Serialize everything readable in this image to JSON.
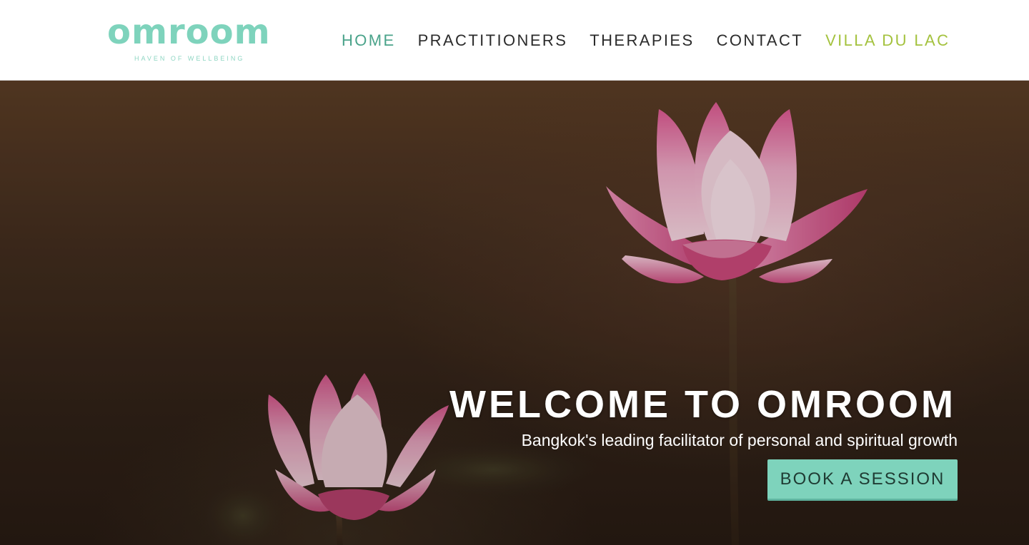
{
  "brand": {
    "name": "omroom",
    "tagline": "HAVEN OF WELLBEING",
    "color": "#7ed3bc"
  },
  "nav": {
    "items": [
      {
        "label": "HOME",
        "state": "active",
        "color": "#4aa38a"
      },
      {
        "label": "PRACTITIONERS"
      },
      {
        "label": "THERAPIES"
      },
      {
        "label": "CONTACT"
      },
      {
        "label": "VILLA DU LAC",
        "color": "#a4c23e"
      }
    ]
  },
  "hero": {
    "title": "WELCOME TO OMROOM",
    "subtitle": "Bangkok's leading facilitator of personal and spiritual growth",
    "cta_label": "BOOK A SESSION",
    "image_subject": "pink lotus flowers on dark brown background",
    "colors": {
      "background": "#3a281c",
      "cta": "#7ed3bc",
      "lotus": "#d9679a"
    }
  }
}
